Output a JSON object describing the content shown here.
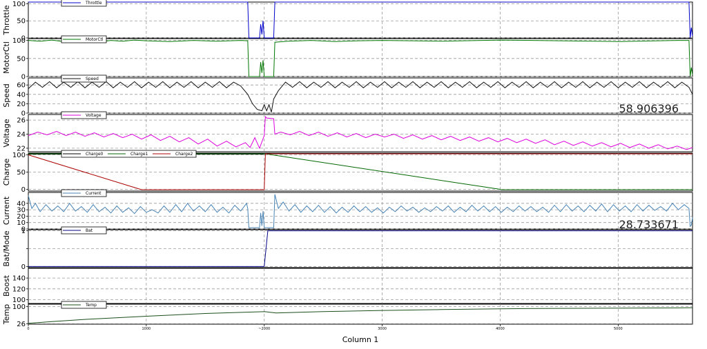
{
  "chart_data": {
    "type": "line",
    "xlabel": "Column 1",
    "xlim": [
      0,
      5630
    ],
    "xticks": [
      0,
      1000,
      2000,
      3000,
      4000,
      5000
    ],
    "xtick_labels": [
      "0",
      "1000",
      "~2000",
      "3000",
      "4000",
      "5000"
    ],
    "grid": true,
    "panels": [
      {
        "id": "throttle",
        "ylabel": "Throttle",
        "ylim": [
          0,
          105
        ],
        "yticks": [
          0,
          50,
          100
        ],
        "legend": [
          "Throttle"
        ],
        "series": [
          {
            "name": "Throttle",
            "color": "#0000cc",
            "x": [
              0,
              1000,
              1860,
              1870,
              1880,
              1960,
              1970,
              1980,
              1990,
              2000,
              2010,
              2040,
              2080,
              2090,
              2100,
              3000,
              4000,
              5000,
              5600,
              5610,
              5620,
              5630
            ],
            "y": [
              105,
              105,
              105,
              0,
              0,
              0,
              40,
              10,
              50,
              0,
              0,
              0,
              0,
              105,
              105,
              105,
              105,
              105,
              105,
              0,
              30,
              5
            ]
          }
        ]
      },
      {
        "id": "motorctl",
        "ylabel": "MotorCtl",
        "ylim": [
          0,
          105
        ],
        "yticks": [
          0,
          50,
          100
        ],
        "legend": [
          "MotorCtl"
        ],
        "series": [
          {
            "name": "MotorCtl",
            "color": "#007700",
            "x": [
              0,
              100,
              200,
              300,
              400,
              500,
              600,
              700,
              800,
              900,
              1000,
              1200,
              1400,
              1600,
              1800,
              1860,
              1870,
              1960,
              1970,
              1980,
              1990,
              2000,
              2080,
              2090,
              2200,
              2400,
              2600,
              2800,
              3000,
              3500,
              4000,
              4500,
              5000,
              5500,
              5600,
              5610,
              5620,
              5630
            ],
            "y": [
              100,
              98,
              101,
              97,
              100,
              99,
              96,
              100,
              98,
              101,
              99,
              97,
              100,
              98,
              100,
              99,
              0,
              0,
              40,
              10,
              45,
              0,
              0,
              95,
              98,
              100,
              97,
              99,
              100,
              98,
              101,
              99,
              97,
              100,
              100,
              0,
              25,
              5
            ]
          }
        ]
      },
      {
        "id": "speed",
        "ylabel": "Speed",
        "ylim": [
          0,
          75
        ],
        "yticks": [
          0,
          20,
          40,
          60
        ],
        "legend": [
          "Speed"
        ],
        "readout": "58.906396",
        "series": [
          {
            "name": "Speed",
            "color": "#111111",
            "x": [
              0,
              60,
              120,
              180,
              240,
              300,
              360,
              420,
              480,
              540,
              600,
              660,
              720,
              780,
              840,
              900,
              960,
              1020,
              1080,
              1140,
              1200,
              1260,
              1320,
              1380,
              1440,
              1500,
              1560,
              1620,
              1680,
              1740,
              1800,
              1860,
              1900,
              1940,
              1980,
              2000,
              2020,
              2040,
              2060,
              2080,
              2120,
              2180,
              2240,
              2300,
              2360,
              2420,
              2480,
              2540,
              2600,
              2660,
              2720,
              2780,
              2840,
              2900,
              2960,
              3020,
              3080,
              3140,
              3200,
              3260,
              3320,
              3380,
              3440,
              3500,
              3560,
              3620,
              3680,
              3740,
              3800,
              3860,
              3920,
              3980,
              4040,
              4100,
              4160,
              4220,
              4280,
              4340,
              4400,
              4460,
              4520,
              4580,
              4640,
              4700,
              4760,
              4820,
              4880,
              4940,
              5000,
              5060,
              5120,
              5180,
              5240,
              5300,
              5360,
              5420,
              5480,
              5540,
              5600,
              5630
            ],
            "y": [
              52,
              66,
              55,
              67,
              54,
              66,
              55,
              67,
              54,
              66,
              55,
              67,
              54,
              66,
              55,
              67,
              54,
              66,
              55,
              67,
              54,
              66,
              55,
              67,
              54,
              66,
              55,
              67,
              54,
              66,
              58,
              40,
              20,
              8,
              5,
              18,
              5,
              18,
              2,
              30,
              48,
              66,
              55,
              67,
              54,
              66,
              55,
              67,
              54,
              66,
              55,
              67,
              54,
              66,
              55,
              67,
              54,
              66,
              55,
              67,
              54,
              66,
              55,
              67,
              54,
              66,
              55,
              67,
              54,
              66,
              55,
              67,
              54,
              66,
              55,
              67,
              54,
              66,
              55,
              67,
              54,
              66,
              55,
              67,
              54,
              66,
              55,
              67,
              54,
              66,
              55,
              67,
              54,
              66,
              55,
              67,
              54,
              66,
              55,
              40
            ]
          }
        ]
      },
      {
        "id": "voltage",
        "ylabel": "Voltage",
        "ylim": [
          21.5,
          26.8
        ],
        "yticks": [
          22,
          24,
          26
        ],
        "legend": [
          "Voltage"
        ],
        "series": [
          {
            "name": "Voltage",
            "color": "#dd00dd",
            "x": [
              0,
              80,
              160,
              240,
              320,
              400,
              480,
              560,
              640,
              720,
              800,
              880,
              960,
              1040,
              1120,
              1200,
              1280,
              1360,
              1440,
              1520,
              1600,
              1680,
              1760,
              1840,
              1880,
              1920,
              1960,
              2000,
              2010,
              2020,
              2080,
              2090,
              2140,
              2220,
              2300,
              2380,
              2460,
              2540,
              2620,
              2700,
              2780,
              2860,
              2940,
              3020,
              3100,
              3180,
              3260,
              3340,
              3420,
              3500,
              3580,
              3660,
              3740,
              3820,
              3900,
              3980,
              4060,
              4140,
              4220,
              4300,
              4380,
              4460,
              4540,
              4620,
              4700,
              4780,
              4860,
              4940,
              5020,
              5100,
              5180,
              5260,
              5340,
              5420,
              5500,
              5580,
              5630
            ],
            "y": [
              23.8,
              24.3,
              23.9,
              24.4,
              23.8,
              24.3,
              23.7,
              24.2,
              23.6,
              24.1,
              23.5,
              24.0,
              23.3,
              23.9,
              23.1,
              23.7,
              22.9,
              23.5,
              22.6,
              23.3,
              22.3,
              23.0,
              22.2,
              22.8,
              22.1,
              23.5,
              22.0,
              23.8,
              26.5,
              26.3,
              26.2,
              24.0,
              24.3,
              23.9,
              24.4,
              23.8,
              24.3,
              23.7,
              24.2,
              23.6,
              24.1,
              23.5,
              24.0,
              23.6,
              24.0,
              23.4,
              23.9,
              23.3,
              23.8,
              23.2,
              23.7,
              23.1,
              23.6,
              23.0,
              23.5,
              22.9,
              23.4,
              22.8,
              23.3,
              22.7,
              23.2,
              22.5,
              23.0,
              22.4,
              22.9,
              22.3,
              22.8,
              22.2,
              22.7,
              22.1,
              22.6,
              22.0,
              22.5,
              21.9,
              22.3,
              21.8,
              22.1
            ]
          }
        ]
      },
      {
        "id": "charge",
        "ylabel": "Charge",
        "ylim": [
          -5,
          105
        ],
        "yticks": [
          0,
          50,
          100
        ],
        "legend": [
          "Charge0",
          "Charge1",
          "Charge2"
        ],
        "series": [
          {
            "name": "Charge0",
            "color": "#000000",
            "x": [
              0,
              2000,
              2010,
              5630
            ],
            "y": [
              102,
              102,
              103,
              103
            ]
          },
          {
            "name": "Charge1",
            "color": "#006600",
            "x": [
              0,
              2000,
              2010,
              4000,
              4010,
              5630
            ],
            "y": [
              103,
              103,
              103,
              0,
              -1,
              -1
            ]
          },
          {
            "name": "Charge2",
            "color": "#aa0000",
            "x": [
              0,
              950,
              960,
              2000,
              2010,
              5630
            ],
            "y": [
              100,
              0,
              -1,
              -1,
              103,
              103
            ]
          }
        ]
      },
      {
        "id": "current",
        "ylabel": "Current",
        "ylim": [
          0,
          57
        ],
        "yticks": [
          0,
          10,
          20,
          30,
          40
        ],
        "legend": [
          "Current"
        ],
        "readout": "28.733671",
        "series": [
          {
            "name": "Current",
            "color": "#4682b4",
            "x": [
              0,
              30,
              60,
              100,
              150,
              200,
              250,
              300,
              350,
              400,
              450,
              500,
              550,
              600,
              650,
              700,
              750,
              800,
              850,
              900,
              950,
              1000,
              1050,
              1100,
              1150,
              1200,
              1250,
              1300,
              1350,
              1400,
              1450,
              1500,
              1550,
              1600,
              1650,
              1700,
              1750,
              1800,
              1850,
              1860,
              1870,
              1960,
              1970,
              1980,
              1990,
              2000,
              2040,
              2060,
              2080,
              2090,
              2120,
              2160,
              2210,
              2260,
              2310,
              2360,
              2410,
              2460,
              2510,
              2560,
              2610,
              2660,
              2710,
              2760,
              2810,
              2860,
              2910,
              2960,
              3010,
              3060,
              3110,
              3160,
              3210,
              3260,
              3310,
              3360,
              3410,
              3460,
              3510,
              3560,
              3610,
              3660,
              3710,
              3760,
              3810,
              3860,
              3910,
              3960,
              4010,
              4060,
              4110,
              4160,
              4210,
              4260,
              4310,
              4360,
              4410,
              4460,
              4510,
              4560,
              4610,
              4660,
              4710,
              4760,
              4810,
              4860,
              4910,
              4960,
              5010,
              5060,
              5110,
              5160,
              5210,
              5260,
              5310,
              5360,
              5410,
              5460,
              5510,
              5560,
              5600,
              5610,
              5620,
              5630
            ],
            "y": [
              52,
              32,
              40,
              27,
              38,
              28,
              36,
              27,
              40,
              28,
              35,
              26,
              38,
              27,
              34,
              25,
              36,
              26,
              33,
              24,
              35,
              26,
              30,
              25,
              36,
              26,
              38,
              27,
              40,
              28,
              36,
              27,
              38,
              26,
              34,
              25,
              37,
              28,
              40,
              32,
              2,
              2,
              25,
              5,
              28,
              2,
              2,
              2,
              2,
              54,
              32,
              42,
              28,
              38,
              26,
              36,
              27,
              37,
              26,
              35,
              25,
              34,
              26,
              36,
              27,
              35,
              26,
              33,
              25,
              34,
              27,
              36,
              28,
              34,
              26,
              33,
              27,
              35,
              28,
              36,
              26,
              34,
              27,
              37,
              28,
              36,
              27,
              35,
              26,
              34,
              27,
              36,
              28,
              35,
              27,
              34,
              26,
              37,
              27,
              38,
              28,
              36,
              27,
              37,
              28,
              39,
              27,
              38,
              28,
              36,
              27,
              38,
              28,
              37,
              29,
              35,
              28,
              40,
              30,
              38,
              32,
              4,
              6,
              18
            ]
          }
        ]
      },
      {
        "id": "batmode",
        "ylabel": "Bat/Mode",
        "ylim": [
          -0.03,
          1.03
        ],
        "yticks": [
          0,
          0.5,
          1
        ],
        "ytick_labels": [
          "0",
          "",
          "1"
        ],
        "legend": [
          "Bat"
        ],
        "series": [
          {
            "name": "Bat",
            "color": "#000080",
            "x": [
              0,
              2000,
              2030,
              5630
            ],
            "y": [
              0,
              0,
              1,
              1
            ]
          }
        ]
      },
      {
        "id": "boost",
        "ylabel": "Boost",
        "ylim": [
          93,
          158
        ],
        "yticks": [
          100,
          120,
          140
        ],
        "legend": [],
        "series": []
      },
      {
        "id": "temp",
        "ylabel": "Temp",
        "ylim": [
          24,
          110
        ],
        "yticks": [
          26,
          100
        ],
        "ytick_labels": [
          "26",
          "100"
        ],
        "legend": [
          "Temp"
        ],
        "series": [
          {
            "name": "Temp",
            "color": "#1a4d1a",
            "x": [
              0,
              200,
              500,
              1000,
              1500,
              2000,
              2100,
              2500,
              3000,
              3500,
              4000,
              4500,
              5000,
              5500,
              5630
            ],
            "y": [
              28,
              35,
              45,
              58,
              70,
              78,
              72,
              78,
              83,
              87,
              90,
              92,
              93,
              94,
              95
            ]
          }
        ]
      }
    ]
  }
}
